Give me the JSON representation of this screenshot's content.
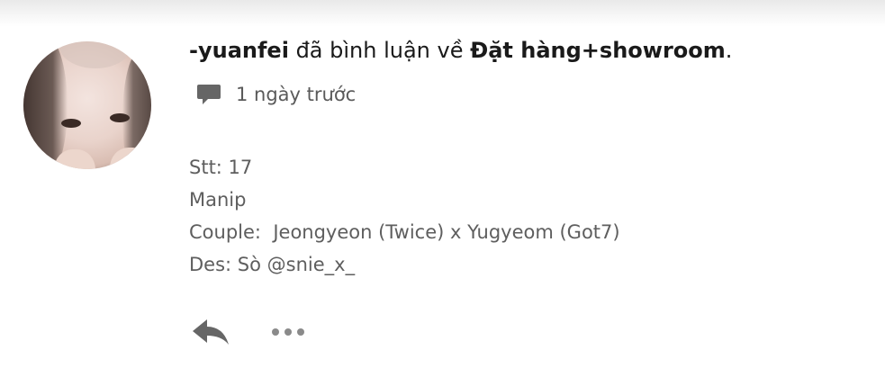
{
  "comment": {
    "username": "-yuanfei",
    "action_text": "đã bình luận về",
    "target": "Đặt hàng+showroom",
    "punctuation": ".",
    "time": "1 ngày trước",
    "time_icon": "comment-icon",
    "lines": [
      "Stt: 17",
      "Manip",
      "Couple:  Jeongyeon (Twice) x Yugyeom (Got7)",
      "Des: Sò @snie_x_"
    ]
  },
  "actions": {
    "reply_icon": "reply-icon",
    "more_icon": "more-options-icon"
  },
  "colors": {
    "text_primary": "#1a1a1a",
    "text_secondary": "#5e5e5e",
    "icon": "#6a6a6a"
  }
}
